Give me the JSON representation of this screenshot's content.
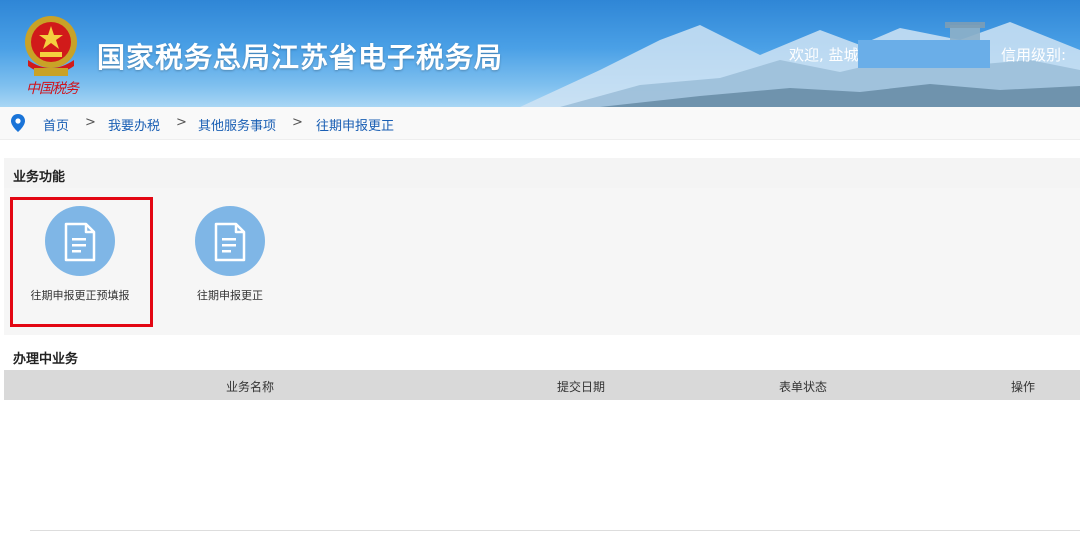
{
  "header": {
    "title": "国家税务总局江苏省电子税务局",
    "brand_text": "中国税务",
    "welcome": "欢迎, 盐城",
    "credit_label": "信用级别:"
  },
  "breadcrumb": [
    "首页",
    "我要办税",
    "其他服务事项",
    "往期申报更正"
  ],
  "breadcrumb_sep": ">",
  "sections": {
    "functions_title": "业务功能",
    "in_progress_title": "办理中业务"
  },
  "tiles": [
    {
      "label": "往期申报更正预填报",
      "icon": "document-icon",
      "highlighted": true
    },
    {
      "label": "往期申报更正",
      "icon": "document-icon",
      "highlighted": false
    }
  ],
  "table": {
    "columns": [
      "业务名称",
      "提交日期",
      "表单状态",
      "操作"
    ],
    "rows": []
  },
  "colors": {
    "header_blue": "#2f86d6",
    "link_blue": "#1a5fb4",
    "icon_circle": "#7fb6e6",
    "highlight_red": "#e30613"
  }
}
